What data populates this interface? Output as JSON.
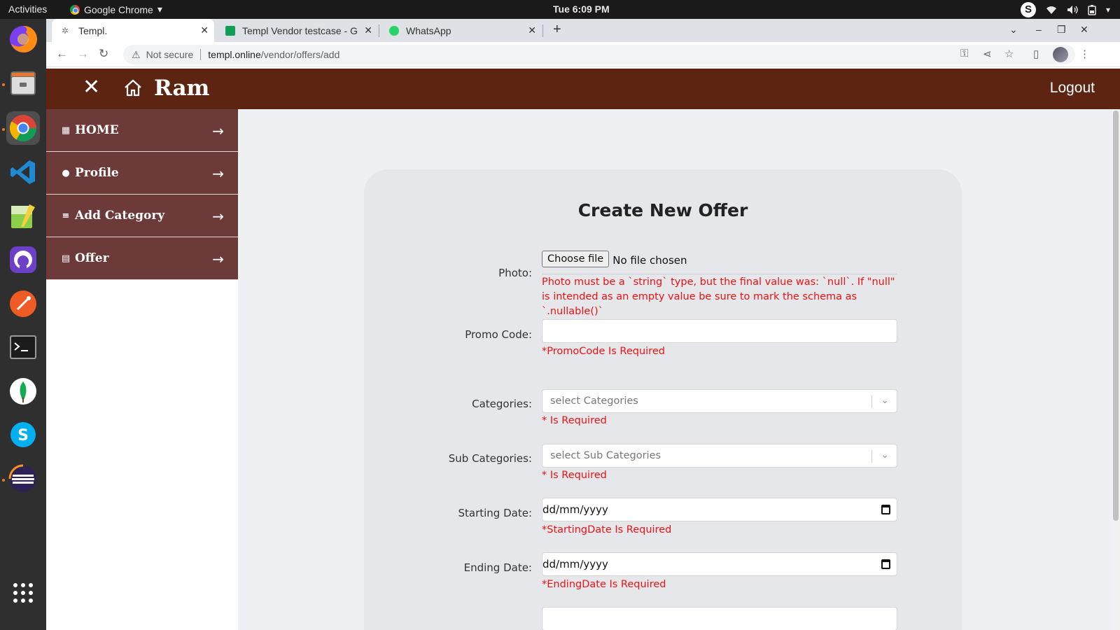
{
  "system_bar": {
    "activities": "Activities",
    "app_name": "Google Chrome",
    "clock": "Tue  6:09 PM",
    "skype_badge": "S"
  },
  "dock": {
    "items": [
      {
        "name": "firefox-icon"
      },
      {
        "name": "files-icon"
      },
      {
        "name": "chrome-icon"
      },
      {
        "name": "vscode-icon"
      },
      {
        "name": "text-editor-icon"
      },
      {
        "name": "github-icon"
      },
      {
        "name": "postman-icon"
      },
      {
        "name": "terminal-icon"
      },
      {
        "name": "mongodb-icon"
      },
      {
        "name": "skype-icon"
      },
      {
        "name": "eclipse-icon"
      },
      {
        "name": "show-apps-icon"
      }
    ]
  },
  "browser": {
    "tabs": [
      {
        "title": "Templ.",
        "active": true
      },
      {
        "title": "Templ Vendor testcase - G",
        "active": false
      },
      {
        "title": "WhatsApp",
        "active": false
      }
    ],
    "new_tab": "+",
    "security_label": "Not secure",
    "url_host": "templ.online",
    "url_path": "/vendor/offers/add"
  },
  "app": {
    "brand": "Ram",
    "logout_label": "Logout",
    "sidebar": {
      "items": [
        {
          "label": "HOME",
          "icon": "dashboard-icon"
        },
        {
          "label": "Profile",
          "icon": "user-icon"
        },
        {
          "label": "Add Category",
          "icon": "list-icon"
        },
        {
          "label": "Offer",
          "icon": "clipboard-icon"
        }
      ]
    }
  },
  "form": {
    "title": "Create New Offer",
    "photo": {
      "label": "Photo:",
      "button": "Choose file",
      "status": "No file chosen",
      "error": "Photo must be a `string` type, but the final value was: `null`. If \"null\" is intended as an empty value be sure to mark the schema as `.nullable()`"
    },
    "promo_code": {
      "label": "Promo Code:",
      "value": "",
      "error": "*PromoCode Is Required"
    },
    "categories": {
      "label": "Categories:",
      "placeholder": "select Categories",
      "error": "* Is Required"
    },
    "sub_categories": {
      "label": "Sub Categories:",
      "placeholder": "select Sub Categories",
      "error": "* Is Required"
    },
    "starting_date": {
      "label": "Starting Date:",
      "value": "dd/mm/yyyy",
      "error": "*StartingDate Is Required"
    },
    "ending_date": {
      "label": "Ending Date:",
      "value": "dd/mm/yyyy",
      "error": "*EndingDate Is Required"
    }
  },
  "colors": {
    "header_bg": "#5c2411",
    "sidebar_item_bg": "#6d3a3a",
    "error_text": "#e11111",
    "page_bg": "#eef0f3",
    "card_bg": "#e6e7ea"
  }
}
